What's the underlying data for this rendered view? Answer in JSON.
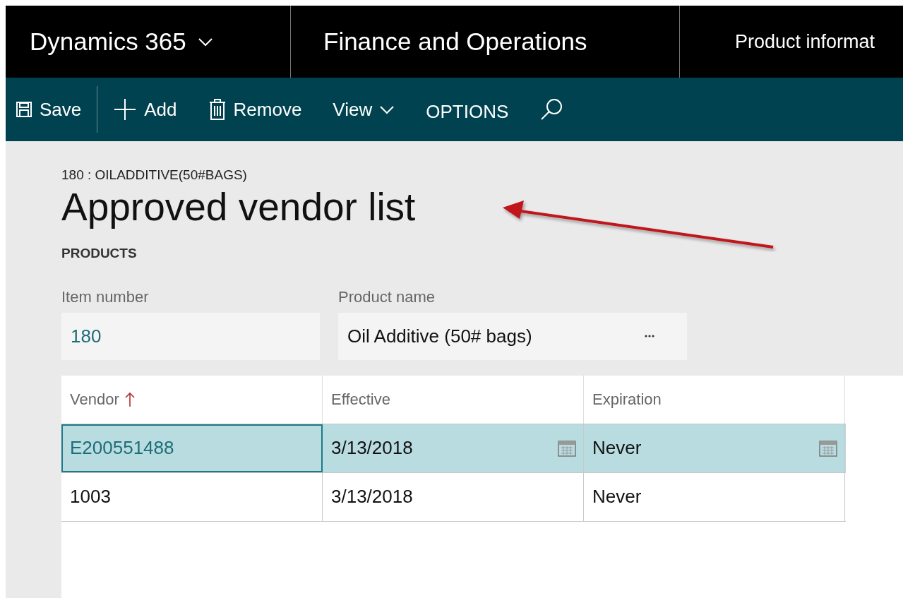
{
  "nav_bar": {
    "app": "Dynamics 365",
    "module": "Finance and Operations",
    "area": "Product informat"
  },
  "toolbar": [
    {
      "label": "Save",
      "kind": "save"
    },
    {
      "label": "Add",
      "kind": "add"
    },
    {
      "label": "Remove",
      "kind": "remove"
    },
    {
      "label": "View",
      "kind": "view"
    },
    {
      "label": "OPTIONS",
      "kind": "options"
    },
    {
      "kind": "search"
    }
  ],
  "page": {
    "breadcrumb": "180 : OILADDITIVE(50#BAGS)",
    "title": "Approved vendor list",
    "section": "PRODUCTS"
  },
  "fields": [
    {
      "label": "Item number",
      "value": "180",
      "kind": "text"
    },
    {
      "label": "Product name",
      "value": "Oil Additive (50# bags)",
      "kind": "lookup"
    }
  ],
  "table": {
    "columns": [
      {
        "label": "Vendor",
        "sorted": true
      },
      {
        "label": "Effective",
        "sorted": false
      },
      {
        "label": "Expiration",
        "sorted": false
      }
    ],
    "rows": [
      {
        "cells": [
          "E200551488",
          "3/13/2018",
          "Never"
        ],
        "selected": true
      },
      {
        "cells": [
          "1003",
          "3/13/2018",
          "Never"
        ],
        "selected": false
      }
    ]
  }
}
